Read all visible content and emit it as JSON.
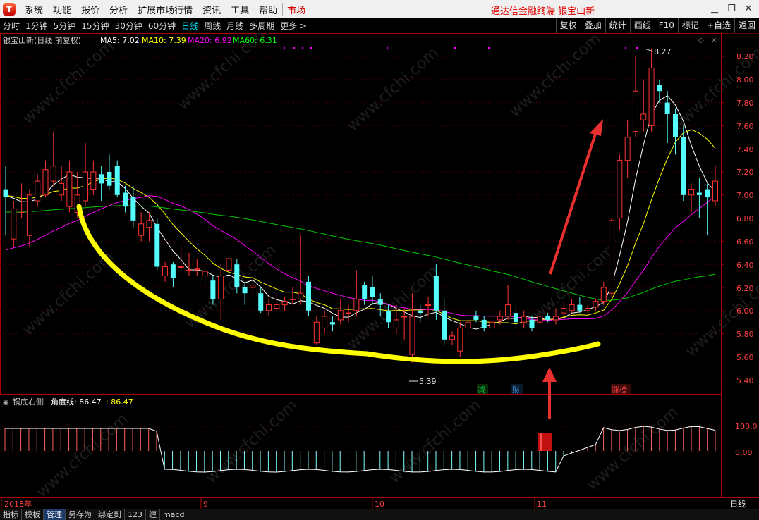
{
  "menubar": {
    "logo_text": "T",
    "items": [
      "系统",
      "功能",
      "报价",
      "分析",
      "扩展市场行情",
      "资讯",
      "工具",
      "帮助"
    ],
    "market": "市场",
    "app_title": "通达信金融终端  银宝山新",
    "window_icons": [
      "minimize-icon",
      "restore-icon",
      "close-icon"
    ]
  },
  "toolbar": {
    "periods": [
      "分时",
      "1分钟",
      "5分钟",
      "15分钟",
      "30分钟",
      "60分钟",
      "日线",
      "周线",
      "月线",
      "多周期",
      "更多 >"
    ],
    "active_period": "日线",
    "right_buttons": [
      "复权",
      "叠加",
      "统计",
      "画线",
      "F10",
      "标记",
      "+自选",
      "返回"
    ]
  },
  "main_chart": {
    "header_name": "银宝山新(日线 前复权)",
    "ma": [
      {
        "label": "MA5: 7.02",
        "color": "#ffffff"
      },
      {
        "label": "MA10: 7.39",
        "color": "#ffff00"
      },
      {
        "label": "MA20: 6.92",
        "color": "#ff00ff"
      },
      {
        "label": "MA60: 6.31",
        "color": "#00ff00"
      }
    ],
    "price_ticks": [
      "8.20",
      "8.00",
      "7.80",
      "7.60",
      "7.40",
      "7.20",
      "7.00",
      "6.80",
      "6.60",
      "6.40",
      "6.20",
      "6.00",
      "5.80",
      "5.60",
      "5.40"
    ],
    "high_label": "8.27",
    "low_label": "5.39",
    "markers": [
      {
        "text": "减",
        "color": "#00c040"
      },
      {
        "text": "财",
        "color": "#4aa0ff"
      },
      {
        "text": "涨榜",
        "color": "#ff4040"
      }
    ],
    "colors": {
      "up": "#ff3232",
      "down": "#54fcfc",
      "axis": "#b00000"
    }
  },
  "indicator": {
    "name": "锅底右侧",
    "line_label": "角度线: 86.47",
    "value": ": 86.47",
    "ticks": [
      "100.0",
      "0.00"
    ]
  },
  "x_axis": {
    "labels": [
      "2018年",
      "9",
      "10",
      "11"
    ],
    "period_label": "日线"
  },
  "bottombar": {
    "tabs": [
      "指标",
      "模板",
      "管理",
      "另存为",
      "绑定到",
      "123",
      "缠",
      "macd"
    ],
    "active": "管理"
  },
  "watermark": "www.cfchi.com"
}
